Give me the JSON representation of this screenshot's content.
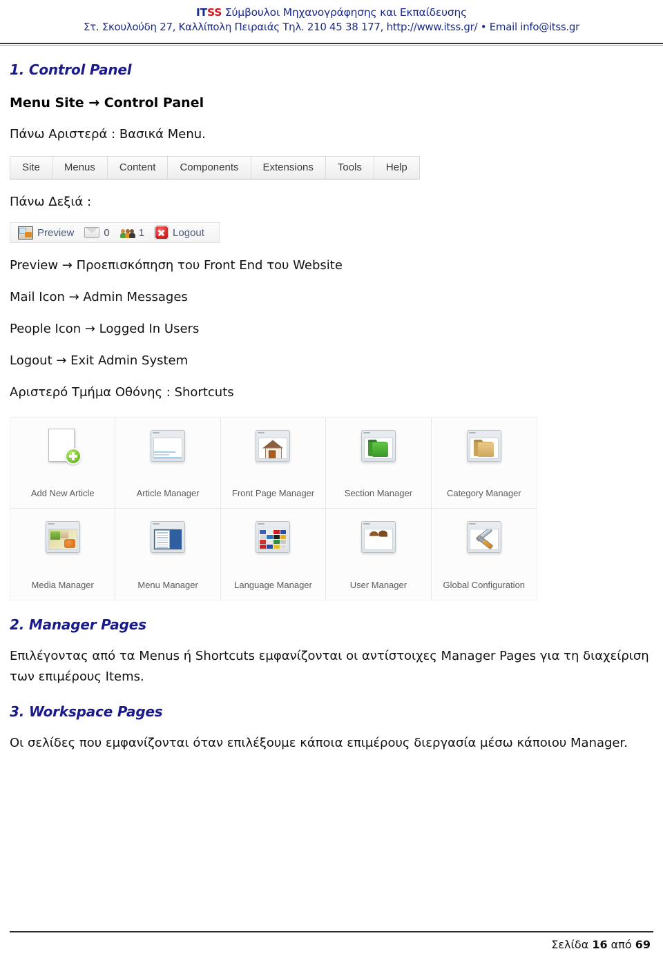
{
  "header": {
    "brand_it": "IT",
    "brand_ss": "SS",
    "brand_tagline": " Σύμβουλοι Μηχανογράφησης και Εκπαίδευσης",
    "address_line": "Στ. Σκουλούδη 27, Καλλίπολη Πειραιάς Τηλ. 210 45 38 177, http://www.itss.gr/ •  Email info@itss.gr",
    "brand_color_it": "#1a2a8c",
    "brand_color_ss": "#d4121c",
    "address_color": "#1c2c86"
  },
  "sections": {
    "s1_title": "1. Control Panel",
    "s1_breadcrumb": "Menu Site → Control Panel",
    "s1_top_left": "Πάνω Αριστερά : Βασικά Menu.",
    "s1_top_right": "Πάνω Δεξιά :",
    "s2_title": "2. Manager Pages",
    "s2_body": "Επιλέγοντας από τα Menus ή Shortcuts εμφανίζονται οι αντίστοιχες Manager Pages για τη διαχείριση των επιμέρους Items.",
    "s3_title": "3. Workspace Pages",
    "s3_body": "Οι σελίδες που εμφανίζονται όταν επιλέξουμε κάποια επιμέρους διεργασία μέσω κάποιου Manager.",
    "shortcuts_label": "Αριστερό Τμήμα Οθόνης : Shortcuts",
    "heading_color": "#1a1a8c"
  },
  "joomla_menubar": {
    "items": [
      {
        "label": "Site"
      },
      {
        "label": "Menus"
      },
      {
        "label": "Content"
      },
      {
        "label": "Components"
      },
      {
        "label": "Extensions"
      },
      {
        "label": "Tools"
      },
      {
        "label": "Help"
      }
    ]
  },
  "joomla_toolbar": {
    "preview_label": "Preview",
    "preview_icon": "preview-screen-icon",
    "messages_count": "0",
    "messages_icon": "mail-envelope-icon",
    "users_count": "1",
    "users_icon": "people-group-icon",
    "logout_label": "Logout",
    "logout_icon": "logout-close-icon"
  },
  "legend": [
    {
      "text": "Preview → Προεπισκόπηση του Front End του Website"
    },
    {
      "text": "Mail Icon → Admin Messages"
    },
    {
      "text": "People Icon → Logged In Users"
    },
    {
      "text": "Logout → Exit Admin System"
    }
  ],
  "shortcuts": [
    {
      "label": "Add New Article",
      "icon": "add-new-article-icon"
    },
    {
      "label": "Article Manager",
      "icon": "article-manager-icon"
    },
    {
      "label": "Front Page Manager",
      "icon": "front-page-manager-icon"
    },
    {
      "label": "Section Manager",
      "icon": "section-manager-icon"
    },
    {
      "label": "Category Manager",
      "icon": "category-manager-icon"
    },
    {
      "label": "Media Manager",
      "icon": "media-manager-icon"
    },
    {
      "label": "Menu Manager",
      "icon": "menu-manager-icon"
    },
    {
      "label": "Language Manager",
      "icon": "language-manager-icon"
    },
    {
      "label": "User Manager",
      "icon": "user-manager-icon"
    },
    {
      "label": "Global Configuration",
      "icon": "global-configuration-icon"
    }
  ],
  "footer": {
    "page_prefix": "Σελίδα ",
    "page_current": "16",
    "page_middle": " από ",
    "page_total": "69",
    "full_text": "Σελίδα 16 από 69"
  }
}
